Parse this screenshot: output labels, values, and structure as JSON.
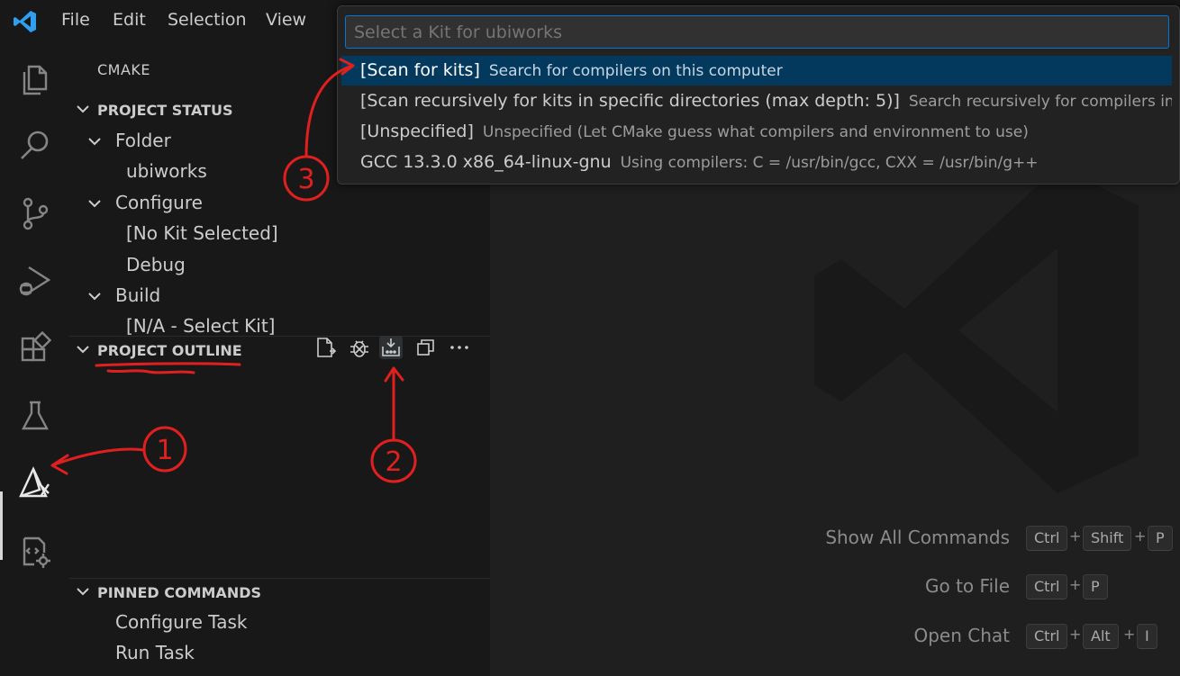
{
  "menubar": {
    "items": [
      "File",
      "Edit",
      "Selection",
      "View"
    ]
  },
  "sidebar": {
    "title": "CMAKE",
    "project_status": {
      "header": "PROJECT STATUS",
      "folder_label": "Folder",
      "folder_value": "ubiworks",
      "configure_label": "Configure",
      "configure_kit": "[No Kit Selected]",
      "configure_type": "Debug",
      "build_label": "Build",
      "build_value": "[N/A - Select Kit]"
    },
    "project_outline": {
      "header": "PROJECT OUTLINE"
    },
    "pinned_commands": {
      "header": "PINNED COMMANDS",
      "items": [
        "Configure Task",
        "Run Task"
      ]
    }
  },
  "quickpick": {
    "placeholder": "Select a Kit for ubiworks",
    "items": [
      {
        "label": "[Scan for kits]",
        "description": "Search for compilers on this computer"
      },
      {
        "label": "[Scan recursively for kits in specific directories (max depth: 5)]",
        "description": "Search recursively for compilers in …"
      },
      {
        "label": "[Unspecified]",
        "description": "Unspecified (Let CMake guess what compilers and environment to use)"
      },
      {
        "label": "GCC 13.3.0 x86_64-linux-gnu",
        "description": "Using compilers: C = /usr/bin/gcc, CXX = /usr/bin/g++"
      }
    ],
    "selected_index": 0
  },
  "shortcuts": [
    {
      "label": "Show All Commands",
      "keys": [
        "Ctrl",
        "Shift",
        "P"
      ]
    },
    {
      "label": "Go to File",
      "keys": [
        "Ctrl",
        "P"
      ]
    },
    {
      "label": "Open Chat",
      "keys": [
        "Ctrl",
        "Alt",
        "I"
      ]
    }
  ],
  "annotations": {
    "marker_1": "1",
    "marker_2": "2",
    "marker_3": "3",
    "color": "#e0201e"
  },
  "colors": {
    "accent": "#0078d4",
    "selection": "#04395e",
    "background": "#1f1f1f",
    "sidebar": "#181818"
  }
}
